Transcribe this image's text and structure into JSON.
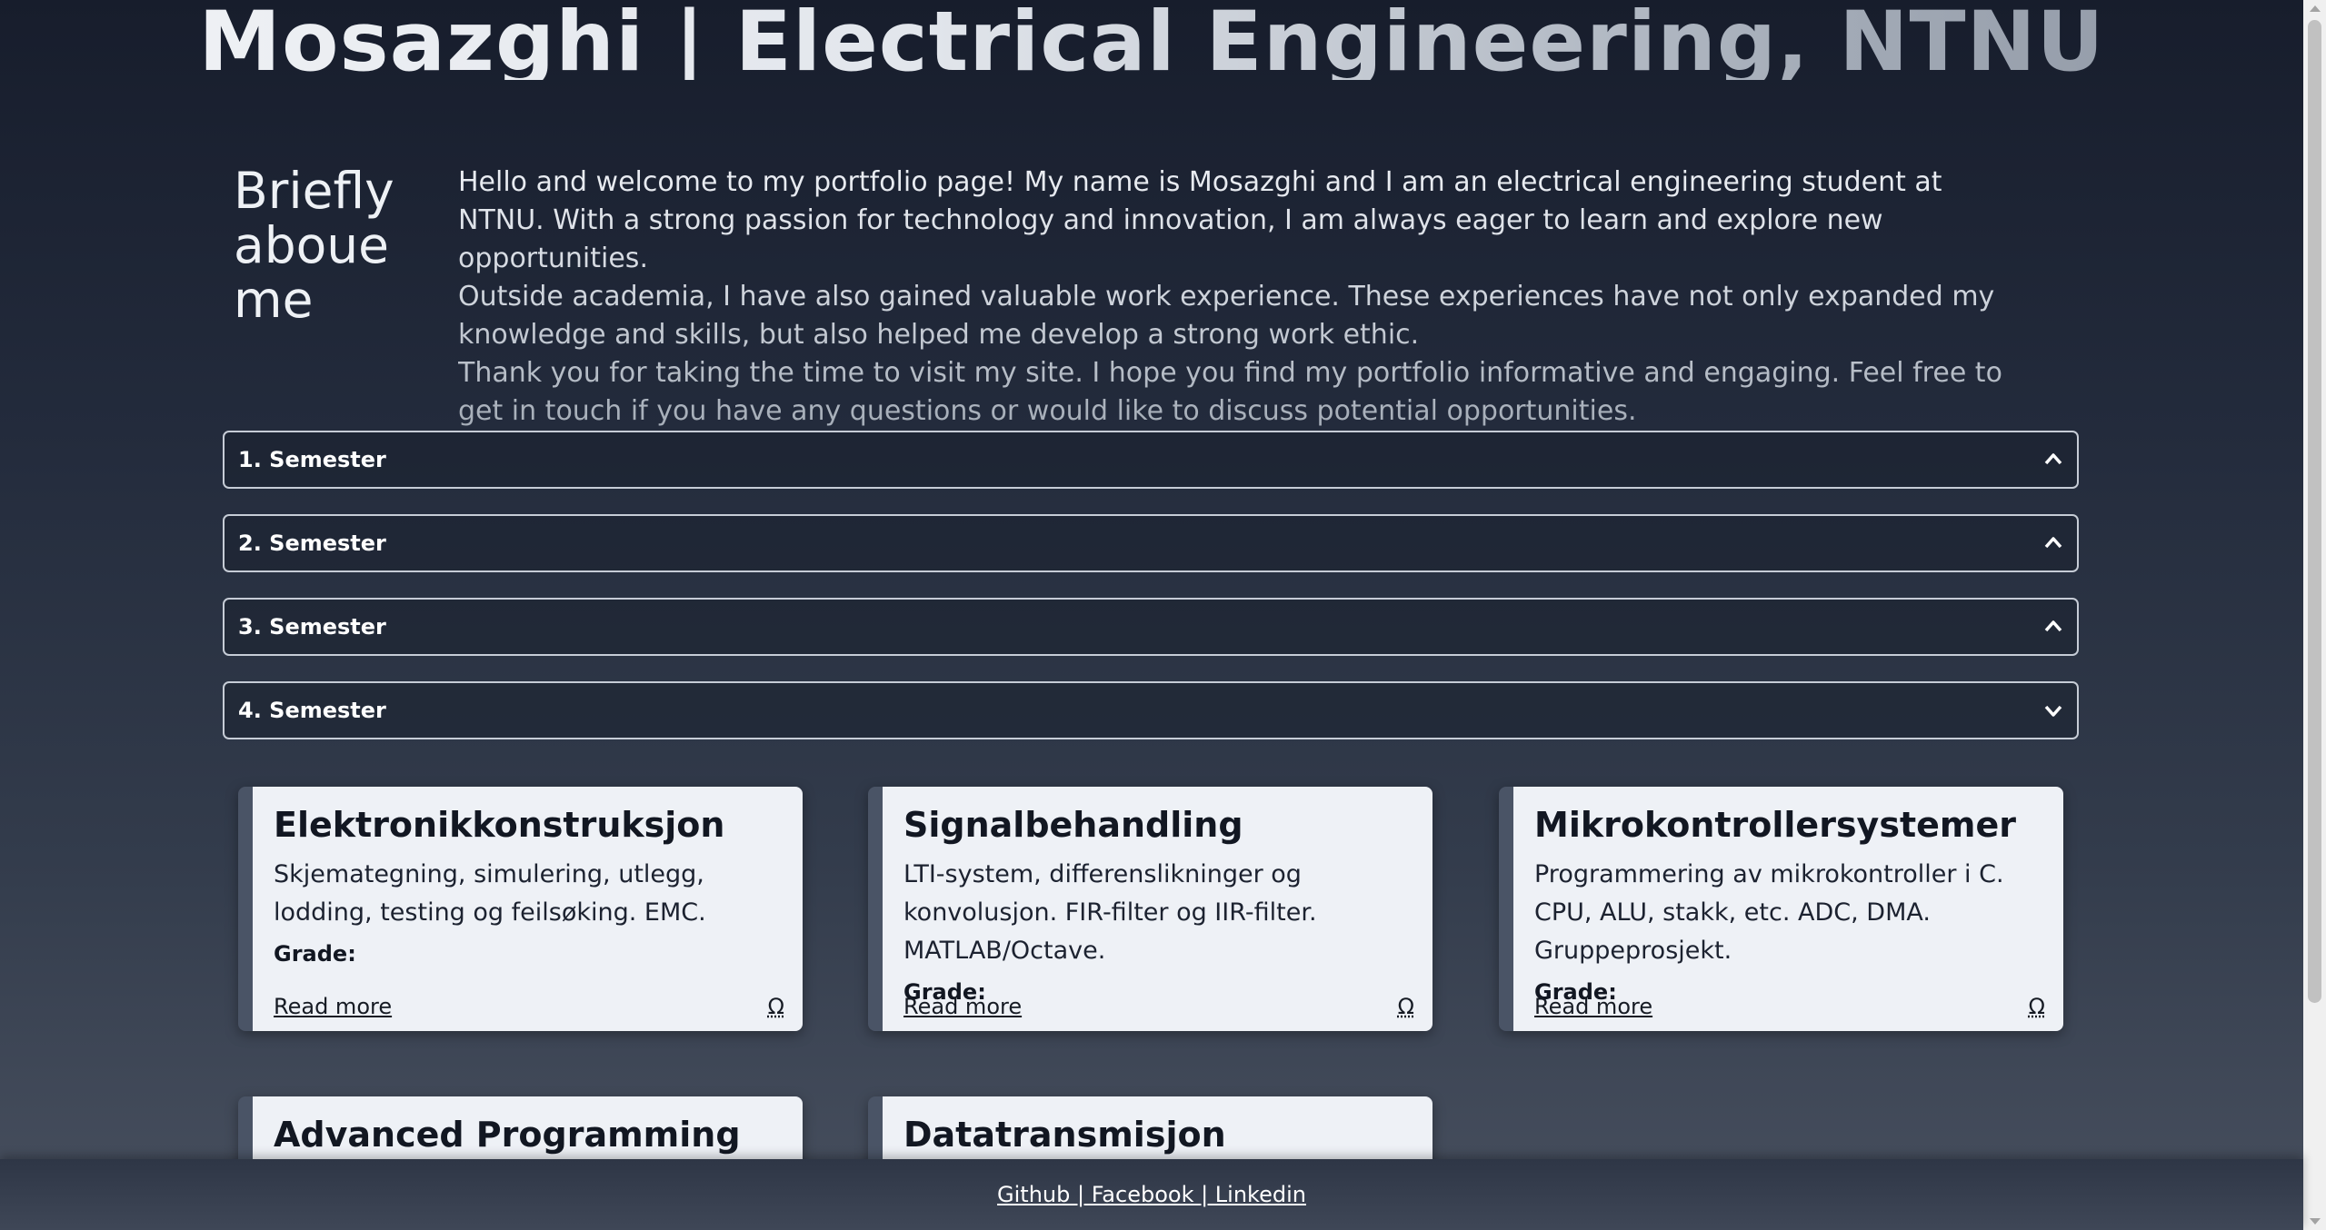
{
  "header": {
    "title": "Mosazghi | Electrical Engineering, NTNU"
  },
  "about": {
    "heading": "Briefly aboue me",
    "paragraphs": [
      "Hello and welcome to my portfolio page! My name is Mosazghi and I am an electrical engineering student at NTNU. With a strong passion for technology and innovation, I am always eager to learn and explore new opportunities.",
      "Outside academia, I have also gained valuable work experience. These experiences have not only expanded my knowledge and skills, but also helped me develop a strong work ethic.",
      "Thank you for taking the time to visit my site. I hope you find my portfolio informative and engaging. Feel free to get in touch if you have any questions or would like to discuss potential opportunities."
    ]
  },
  "semesters": [
    {
      "label": "1. Semester",
      "state": "collapsed",
      "icon": "chevron-up-icon"
    },
    {
      "label": "2. Semester",
      "state": "collapsed",
      "icon": "chevron-up-icon"
    },
    {
      "label": "3. Semester",
      "state": "collapsed",
      "icon": "chevron-up-icon"
    },
    {
      "label": "4. Semester",
      "state": "expanded",
      "icon": "chevron-down-icon"
    }
  ],
  "courses": [
    {
      "title": "Elektronikkonstruksjon",
      "description": "Skjemategning, simulering, utlegg, lodding, testing og feilsøking. EMC.",
      "grade_label": "Grade:",
      "read_more": "Read more",
      "icon_glyph": "Ω"
    },
    {
      "title": "Signalbehandling",
      "description": "LTI-system, differenslikninger og konvolusjon. FIR-filter og IIR-filter. MATLAB/Octave.",
      "grade_label": "Grade:",
      "read_more": "Read more",
      "icon_glyph": "Ω"
    },
    {
      "title": "Mikrokontrollersystemer",
      "description": "Programmering av mikrokontroller i C. CPU, ALU, stakk, etc. ADC, DMA. Gruppeprosjekt.",
      "grade_label": "Grade:",
      "read_more": "Read more",
      "icon_glyph": "Ω"
    },
    {
      "title": "Advanced Programming"
    },
    {
      "title": "Datatransmisjon"
    }
  ],
  "footer": {
    "links_text": "Github | Facebook | Linkedin"
  },
  "colors": {
    "background_top": "#171d2c",
    "background_bottom": "#48505f",
    "card_background": "#eef1f6",
    "card_accent": "#4a5466",
    "accordion_border": "#c6ccd6"
  }
}
